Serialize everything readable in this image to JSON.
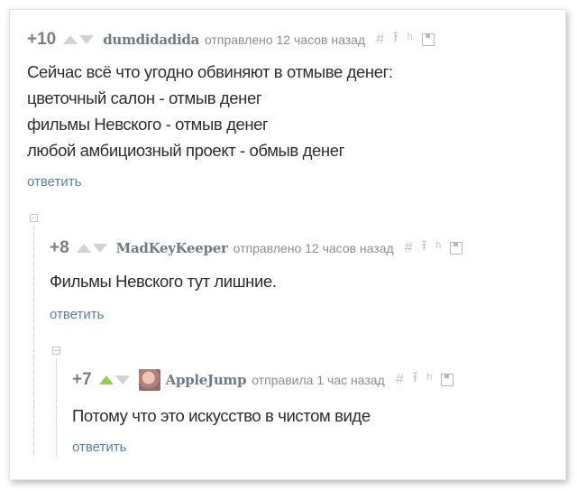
{
  "comments": [
    {
      "rating": "+10",
      "author": "dumdidadida",
      "meta": "отправлено 12 часов назад",
      "lines": [
        "Сейчас всё что угодно обвиняют в отмыве денег:",
        "цветочный салон - отмыв денег",
        "фильмы Невского - отмыв денег",
        "любой амбициозный проект - обмыв денег"
      ],
      "reply_label": "ответить"
    },
    {
      "rating": "+8",
      "author": "MadKeyKeeper",
      "meta": "отправлено 12 часов назад",
      "lines": [
        "Фильмы Невского тут лишние."
      ],
      "reply_label": "ответить"
    },
    {
      "rating": "+7",
      "author": "AppleJump",
      "meta": "отправила 1 час назад",
      "lines": [
        "Потому что это искусство в чистом виде"
      ],
      "reply_label": "ответить"
    }
  ],
  "icons": [
    "hash-icon",
    "pin-icon",
    "branch-icon",
    "save-icon"
  ],
  "colors": {
    "upvote_active": "#8fd24a",
    "vote_inactive": "#d2d2d2",
    "link": "#5a7fa3",
    "author": "#6f7a86"
  }
}
